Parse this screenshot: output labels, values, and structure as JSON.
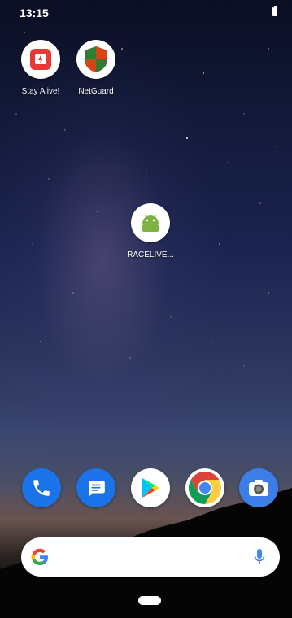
{
  "status_bar": {
    "time": "13:15"
  },
  "home_apps": [
    {
      "label": "Stay Alive!",
      "icon": "stay-alive-icon"
    },
    {
      "label": "NetGuard",
      "icon": "netguard-shield-icon"
    },
    {
      "label": "RACELIVE...",
      "icon": "android-robot-icon"
    }
  ],
  "dock": [
    {
      "name": "phone",
      "icon": "phone-icon"
    },
    {
      "name": "messages",
      "icon": "messages-icon"
    },
    {
      "name": "play-store",
      "icon": "play-store-icon"
    },
    {
      "name": "chrome",
      "icon": "chrome-icon"
    },
    {
      "name": "camera",
      "icon": "camera-icon"
    }
  ],
  "search_bar": {
    "left_icon": "google-g-icon",
    "right_icon": "microphone-icon"
  },
  "colors": {
    "phone": "#1a73e8",
    "messages": "#1a73e8",
    "camera": "#3d7de8",
    "android": "#7cb342"
  }
}
